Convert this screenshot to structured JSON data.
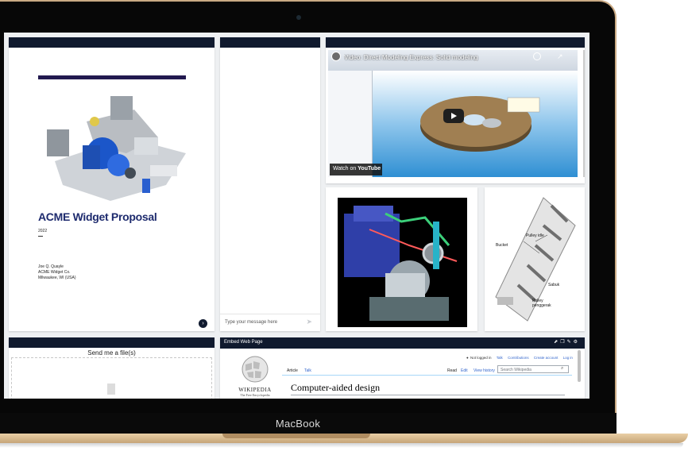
{
  "device": {
    "brand": "MacBook"
  },
  "document": {
    "title": "ACME Widget Proposal",
    "year": "2022",
    "author": "Joe Q. Quayle",
    "company": "ACME Widget Co.",
    "location": "Milwaukee, WI (USA)",
    "next_icon": "›"
  },
  "chat": {
    "placeholder": "Type your message here",
    "send_icon": "➤"
  },
  "video": {
    "title": "Video: Direct Modeling Express: Solid modeling",
    "watch_on": "Watch on",
    "platform": "YouTube"
  },
  "bucket_diagram": {
    "labels": [
      "Pulley idle",
      "Bucket",
      "Sabuk",
      "Pulley",
      "penggerak"
    ]
  },
  "upload": {
    "title": "Send me a file(s)"
  },
  "embed": {
    "title": "Embed Web Page",
    "icons": [
      "external-link-icon",
      "copy-icon",
      "edit-icon",
      "settings-icon"
    ],
    "wiki": {
      "logo_word": "WIKIPEDIA",
      "logo_sub": "The Free Encyclopedia",
      "not_logged_in": "Not logged in",
      "links": [
        "Talk",
        "Contributions",
        "Create account",
        "Log in"
      ],
      "tabs_left": [
        "Article",
        "Talk"
      ],
      "tabs_right": [
        "Read",
        "Edit",
        "View history"
      ],
      "search_placeholder": "Search Wikipedia",
      "heading": "Computer-aided design"
    }
  },
  "colors": {
    "header": "#101a2e",
    "title": "#1e2b6e",
    "accent_bar": "#22194f",
    "link": "#3366cc"
  }
}
